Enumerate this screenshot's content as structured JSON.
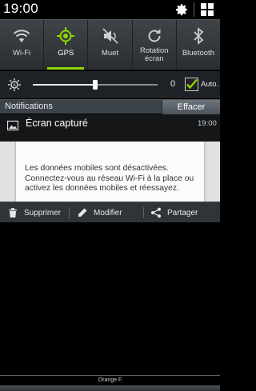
{
  "status_bar": {
    "time": "19:00",
    "settings_icon": "gear-icon",
    "apps_icon": "grid-icon"
  },
  "quick_settings": [
    {
      "label": "Wi-Fi",
      "icon": "wifi-icon",
      "active": false
    },
    {
      "label": "GPS",
      "icon": "gps-icon",
      "active": true
    },
    {
      "label": "Muet",
      "icon": "mute-icon",
      "active": false
    },
    {
      "label_line1": "Rotation",
      "label_line2": "écran",
      "icon": "rotation-icon",
      "active": false
    },
    {
      "label": "Bluetooth",
      "icon": "bluetooth-icon",
      "active": false
    }
  ],
  "brightness": {
    "value_text": "0",
    "level": 0.5,
    "auto_label": "Auto.",
    "auto_checked": true
  },
  "notifications": {
    "header": "Notifications",
    "clear_label": "Effacer",
    "items": [
      {
        "title": "Écran capturé",
        "time": "19:00",
        "icon": "image-icon"
      }
    ]
  },
  "preview": {
    "message": "Les données mobiles sont désactivées. Connectez-vous au réseau Wi-Fi à la place ou activez les données mobiles et réessayez."
  },
  "actions": [
    {
      "label": "Supprimer",
      "icon": "trash-icon"
    },
    {
      "label": "Modifier",
      "icon": "pencil-icon"
    },
    {
      "label": "Partager",
      "icon": "share-icon"
    }
  ],
  "carrier": "Orange F",
  "colors": {
    "accent": "#8fd400",
    "panel": "#2f3439"
  }
}
